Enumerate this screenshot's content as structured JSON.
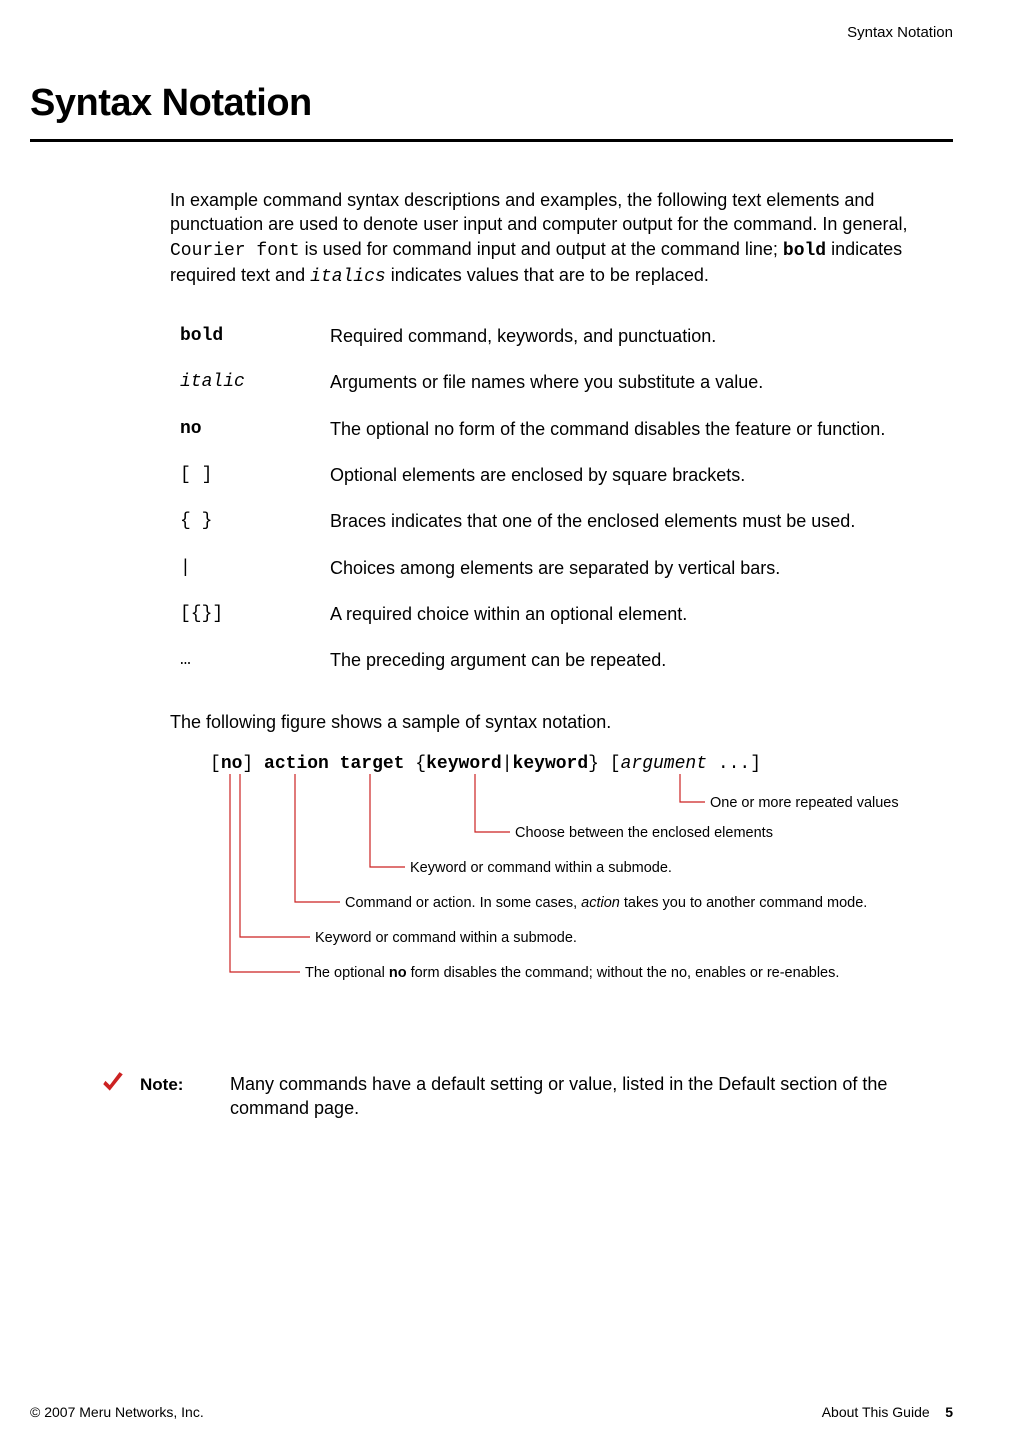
{
  "header_right": "Syntax Notation",
  "title": "Syntax Notation",
  "intro_parts": {
    "a": "In example command syntax descriptions and examples, the following text elements and punctuation are used to denote user input and computer output for the command. In general, ",
    "courier": "Courier font",
    "b": " is used for command input and output at the command line; ",
    "bold": "bold",
    "c": " indicates required text and ",
    "italics": "italics",
    "d": " indicates values that are to be replaced."
  },
  "table": [
    {
      "sym": "bold",
      "sym_class": "bold",
      "desc": "Required command, keywords, and punctuation."
    },
    {
      "sym": "italic",
      "sym_class": "italic",
      "desc": "Arguments or file names where you substitute a value."
    },
    {
      "sym": "no",
      "sym_class": "bold",
      "desc": "The optional no form of the command disables the feature or function."
    },
    {
      "sym": "[ ]",
      "sym_class": "",
      "desc": "Optional elements are enclosed by square brackets."
    },
    {
      "sym": "{ }",
      "sym_class": "",
      "desc": "Braces indicates that one of the enclosed elements must be used."
    },
    {
      "sym": " |",
      "sym_class": "",
      "desc": "Choices among elements are separated by vertical bars."
    },
    {
      "sym": "[{}]",
      "sym_class": "",
      "desc": "A required choice within an optional element."
    },
    {
      "sym": " …",
      "sym_class": "",
      "desc": "The preceding argument can be repeated."
    }
  ],
  "followfig": "The following figure shows a sample of syntax notation.",
  "syntax": {
    "lb1": "[",
    "no": "no",
    "rb1": "]",
    "sp1": " ",
    "action": "action",
    "sp2": " ",
    "target": "target",
    "sp3": " ",
    "lc": "{",
    "kw1": "keyword",
    "pipe": "|",
    "kw2": "keyword",
    "rc": "}",
    "lb2": " [",
    "arg": "argument",
    "dots": " ...",
    "rb2": "]"
  },
  "annotations": {
    "repeated": "One or more repeated values",
    "choose": "Choose between the enclosed elements",
    "keyword": "Keyword or command within a submode.",
    "action_a": "Command or action. In some cases, ",
    "action_em": "action",
    "action_b": " takes you to another command mode.",
    "no_a": "The optional ",
    "no_b": "no",
    "no_c": " form disables the command; without the no, enables or re-enables."
  },
  "note": {
    "label": "Note:",
    "text": "Many commands have a default setting or value, listed in the Default section of the command page."
  },
  "footer": {
    "left": "© 2007 Meru Networks, Inc.",
    "right_text": "About This Guide",
    "right_page": "5"
  }
}
